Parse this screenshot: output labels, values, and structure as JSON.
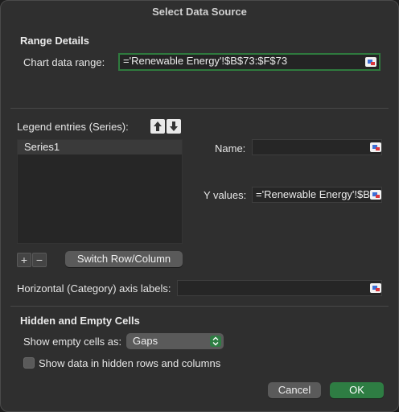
{
  "dialog": {
    "title": "Select Data Source"
  },
  "range": {
    "section_title": "Range Details",
    "label": "Chart data range:",
    "value": "='Renewable Energy'!$B$73:$F$73"
  },
  "legend": {
    "label": "Legend entries (Series):",
    "series": [
      "Series1"
    ],
    "add_symbol": "+",
    "remove_symbol": "−",
    "switch_label": "Switch Row/Column"
  },
  "series_detail": {
    "name_label": "Name:",
    "name_value": "",
    "y_label": "Y values:",
    "y_value": "='Renewable Energy'!$B"
  },
  "axis": {
    "label": "Horizontal (Category) axis labels:",
    "value": ""
  },
  "hidden": {
    "section_title": "Hidden and Empty Cells",
    "empty_label": "Show empty cells as:",
    "empty_value": "Gaps",
    "checkbox_label": "Show data in hidden rows and columns",
    "checkbox_checked": false
  },
  "footer": {
    "cancel_label": "Cancel",
    "ok_label": "OK"
  },
  "colors": {
    "accent_green": "#2e7d43",
    "dialog_bg": "#2f2f2f"
  }
}
